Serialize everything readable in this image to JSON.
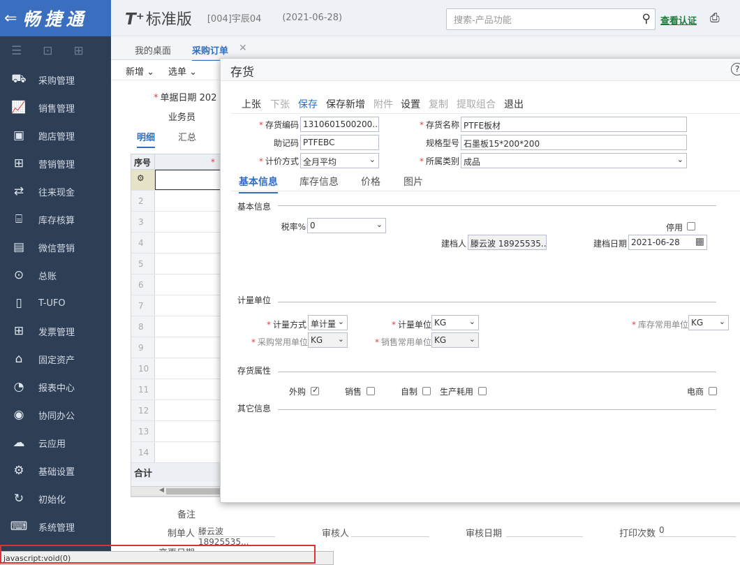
{
  "brand": {
    "back_glyph": "⇐",
    "name": "畅捷通"
  },
  "sidebar": {
    "tools": [
      "☰",
      "⊡",
      "⊞"
    ],
    "items": [
      {
        "label": "采购管理",
        "icon": "cart-icon",
        "glyph": "⛟"
      },
      {
        "label": "销售管理",
        "icon": "chart-up-icon",
        "glyph": "📈"
      },
      {
        "label": "跑店管理",
        "icon": "store-card-icon",
        "glyph": "▣"
      },
      {
        "label": "营销管理",
        "icon": "grid-plus-icon",
        "glyph": "⊞"
      },
      {
        "label": "往来现金",
        "icon": "exchange-icon",
        "glyph": "⇄"
      },
      {
        "label": "库存核算",
        "icon": "warehouse-icon",
        "glyph": "⌸"
      },
      {
        "label": "微信营销",
        "icon": "wechat-doc-icon",
        "glyph": "▤"
      },
      {
        "label": "总账",
        "icon": "ledger-icon",
        "glyph": "⊙"
      },
      {
        "label": "T-UFO",
        "icon": "ufo-doc-icon",
        "glyph": "▯"
      },
      {
        "label": "发票管理",
        "icon": "invoice-grid-icon",
        "glyph": "⊞"
      },
      {
        "label": "固定资产",
        "icon": "bank-icon",
        "glyph": "⌂"
      },
      {
        "label": "报表中心",
        "icon": "pie-chart-icon",
        "glyph": "◔"
      },
      {
        "label": "协同办公",
        "icon": "collab-icon",
        "glyph": "◉"
      },
      {
        "label": "云应用",
        "icon": "cloud-icon",
        "glyph": "☁"
      },
      {
        "label": "基础设置",
        "icon": "settings-gear-icon",
        "glyph": "⚙"
      },
      {
        "label": "初始化",
        "icon": "refresh-icon",
        "glyph": "↻"
      },
      {
        "label": "系统管理",
        "icon": "system-monitor-icon",
        "glyph": "⌨"
      }
    ]
  },
  "header": {
    "logo": "T⁺",
    "edition": "标准版",
    "account": "[004]宇辰04",
    "date": "(2021-06-28)",
    "search_placeholder": "搜索-产品功能",
    "verify_link": "查看认证"
  },
  "tabs": {
    "items": [
      "我的桌面",
      "采购订单"
    ],
    "close_glyph": "✕"
  },
  "page": {
    "toolbar": [
      "新增",
      "选单"
    ],
    "date_label": "单据日期",
    "date_value": "202",
    "salesman_label": "业务员",
    "subtabs": [
      "明细",
      "汇总"
    ],
    "grid_header_no": "序号",
    "grid_header_col": "*",
    "rows": [
      "",
      "2",
      "3",
      "4",
      "5",
      "6",
      "7",
      "8",
      "9",
      "10",
      "11",
      "12",
      "13",
      "14"
    ],
    "first_row_icon": "⚙",
    "total_label": "合计",
    "note_label": "备注",
    "maker_label": "制单人",
    "maker_value": "滕云波 18925535...",
    "reviewer_label": "审核人",
    "review_date_label": "审核日期",
    "print_count_label": "打印次数",
    "print_count_value": "0",
    "change_date_label": "变更日期",
    "status_text": "javascript:void(0)"
  },
  "modal": {
    "title": "存货",
    "help_glyph": "?",
    "toolbar": [
      {
        "label": "上张",
        "state": "on"
      },
      {
        "label": "下张",
        "state": "off"
      },
      {
        "label": "保存",
        "state": "blue"
      },
      {
        "label": "保存新增",
        "state": "on"
      },
      {
        "label": "附件",
        "state": "off"
      },
      {
        "label": "设置",
        "state": "on"
      },
      {
        "label": "复制",
        "state": "off"
      },
      {
        "label": "提取组合",
        "state": "off"
      },
      {
        "label": "退出",
        "state": "on"
      }
    ],
    "fields": {
      "code_label": "存货编码",
      "code_value": "1310601500200...",
      "name_label": "存货名称",
      "name_value": "PTFE板材",
      "mnemonic_label": "助记码",
      "mnemonic_value": "PTFEBC",
      "spec_label": "规格型号",
      "spec_value": "石墨板15*200*200",
      "pricing_label": "计价方式",
      "pricing_value": "全月平均",
      "category_label": "所属类别",
      "category_value": "成品"
    },
    "inner_tabs": [
      "基本信息",
      "库存信息",
      "价格",
      "图片"
    ],
    "basic": {
      "section": "基本信息",
      "tax_label": "税率%",
      "tax_value": "0",
      "disabled_label": "停用",
      "creator_label": "建档人",
      "creator_value": "滕云波 18925535...",
      "create_date_label": "建档日期",
      "create_date_value": "2021-06-28"
    },
    "units": {
      "section": "计量单位",
      "method_label": "计量方式",
      "method_value": "单计量",
      "unit_label": "计量单位",
      "unit_value": "KG",
      "stock_unit_label": "库存常用单位",
      "stock_unit_value": "KG",
      "purchase_unit_label": "采购常用单位",
      "purchase_unit_value": "KG",
      "sales_unit_label": "销售常用单位",
      "sales_unit_value": "KG"
    },
    "attrs": {
      "section": "存货属性",
      "outsource_label": "外购",
      "outsource_checked": true,
      "sales_label": "销售",
      "selfmade_label": "自制",
      "production_label": "生产耗用",
      "ecommerce_label": "电商"
    },
    "other_section": "其它信息"
  }
}
